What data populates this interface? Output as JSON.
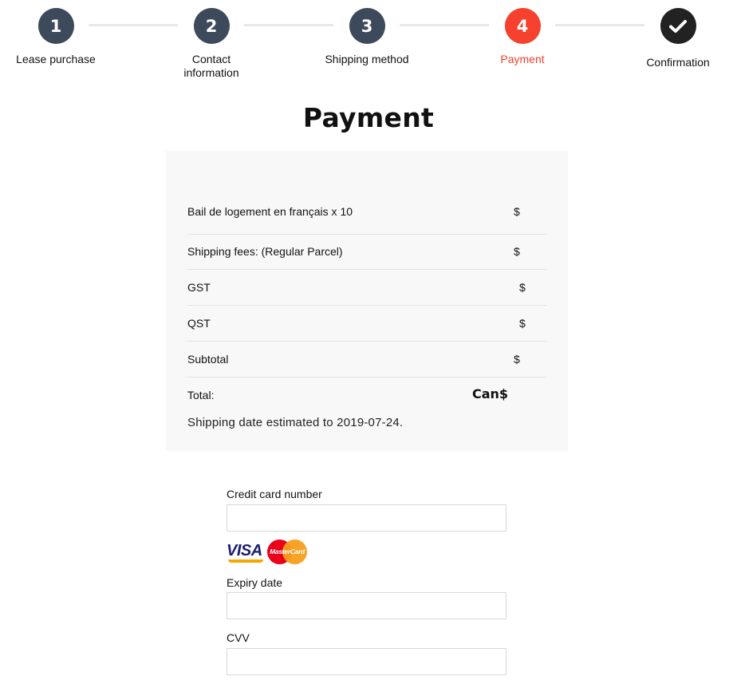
{
  "stepper": {
    "steps": [
      {
        "number": "1",
        "label": "Lease purchase",
        "state": "done",
        "color": "#3d4a5c"
      },
      {
        "number": "2",
        "label": "Contact information",
        "state": "done",
        "color": "#3d4a5c"
      },
      {
        "number": "3",
        "label": "Shipping method",
        "state": "done",
        "color": "#3d4a5c"
      },
      {
        "number": "4",
        "label": "Payment",
        "state": "active",
        "color": "#f5412e"
      },
      {
        "number": "",
        "label": "Confirmation",
        "state": "upcoming",
        "color": "#222222",
        "icon": "checkmark-icon"
      }
    ]
  },
  "page": {
    "title": "Payment"
  },
  "summary": {
    "rows": [
      {
        "label": "Bail de logement en français x 10",
        "amount": "$"
      },
      {
        "label": "Shipping fees: (Regular Parcel)",
        "amount": "$"
      },
      {
        "label": "GST",
        "amount": "$"
      },
      {
        "label": "QST",
        "amount": "$"
      },
      {
        "label": "Subtotal",
        "amount": "$"
      }
    ],
    "total_label": "Total:",
    "total_amount": "Can$",
    "shipping_date": "Shipping date estimated to 2019-07-24."
  },
  "form": {
    "card_number_label": "Credit card number",
    "card_number_value": "",
    "expiry_label": "Expiry date",
    "expiry_value": "",
    "cvv_label": "CVV",
    "cvv_value": "",
    "card_logos": {
      "visa_text": "VISA",
      "mastercard_text": "MasterCard"
    }
  },
  "colors": {
    "active_step": "#f5412e",
    "completed_step": "#3d4a5c",
    "confirm_step": "#222222",
    "summary_bg": "#f8f8f8"
  }
}
